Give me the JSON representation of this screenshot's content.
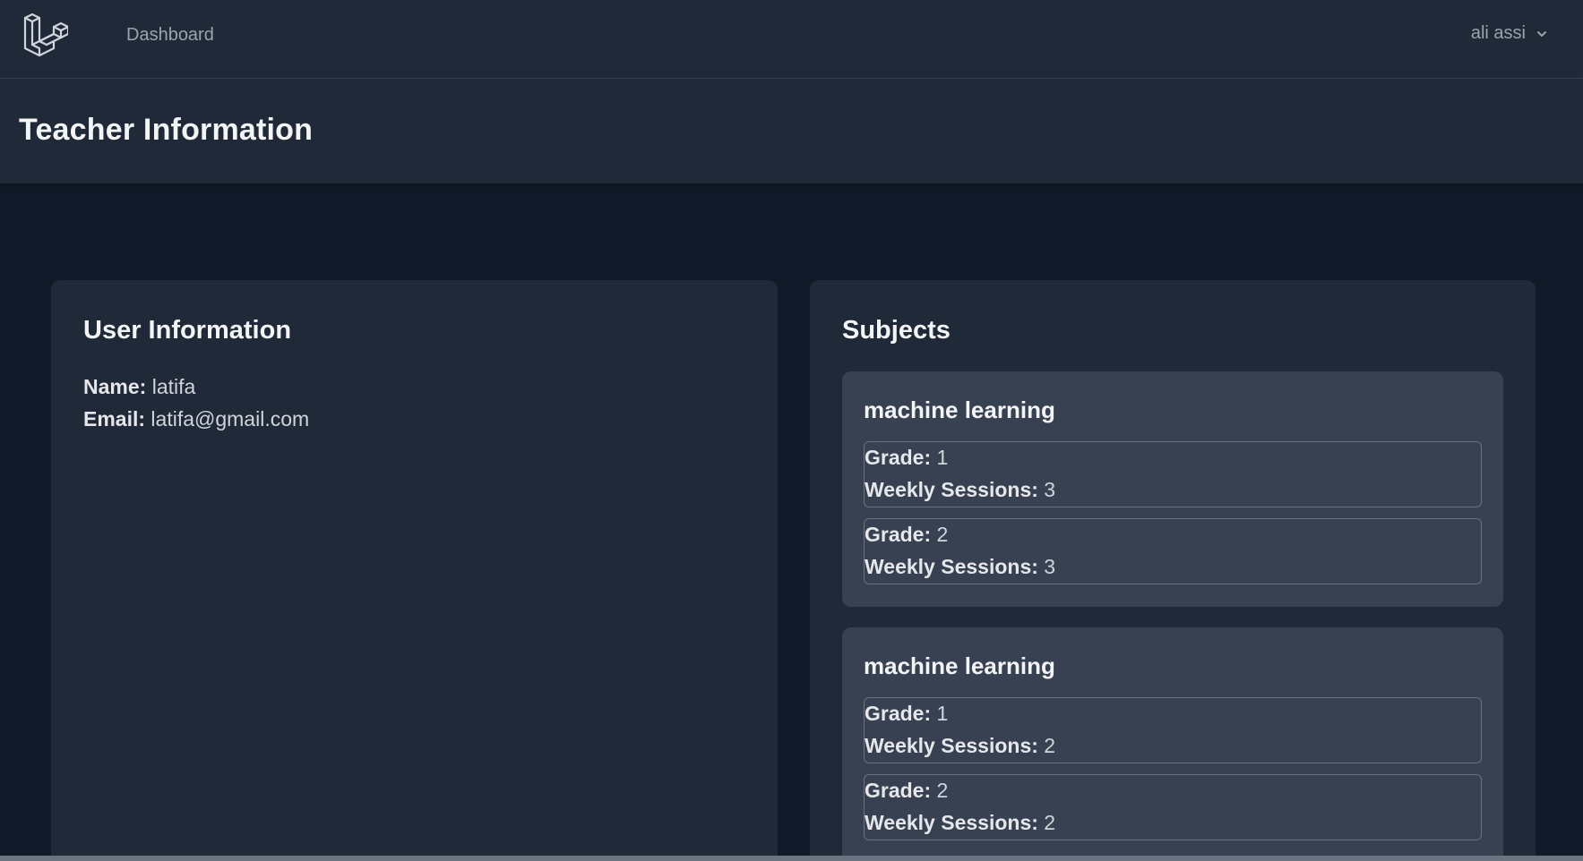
{
  "nav": {
    "dashboard_label": "Dashboard",
    "user_name": "ali assi"
  },
  "header": {
    "title": "Teacher Information"
  },
  "user_info": {
    "title": "User Information",
    "name_label": "Name:",
    "name_value": "latifa",
    "email_label": "Email:",
    "email_value": "latifa@gmail.com"
  },
  "subjects": {
    "title": "Subjects",
    "grade_label": "Grade:",
    "sessions_label": "Weekly Sessions:",
    "items": [
      {
        "name": "machine learning",
        "grades": [
          {
            "grade": "1",
            "sessions": "3"
          },
          {
            "grade": "2",
            "sessions": "3"
          }
        ]
      },
      {
        "name": "machine learning",
        "grades": [
          {
            "grade": "1",
            "sessions": "2"
          },
          {
            "grade": "2",
            "sessions": "2"
          }
        ]
      }
    ]
  },
  "colors": {
    "background": "#111827",
    "panel": "#1f2937",
    "subject_panel": "#374151",
    "text": "#e5e7eb",
    "muted": "#9ca3af"
  }
}
